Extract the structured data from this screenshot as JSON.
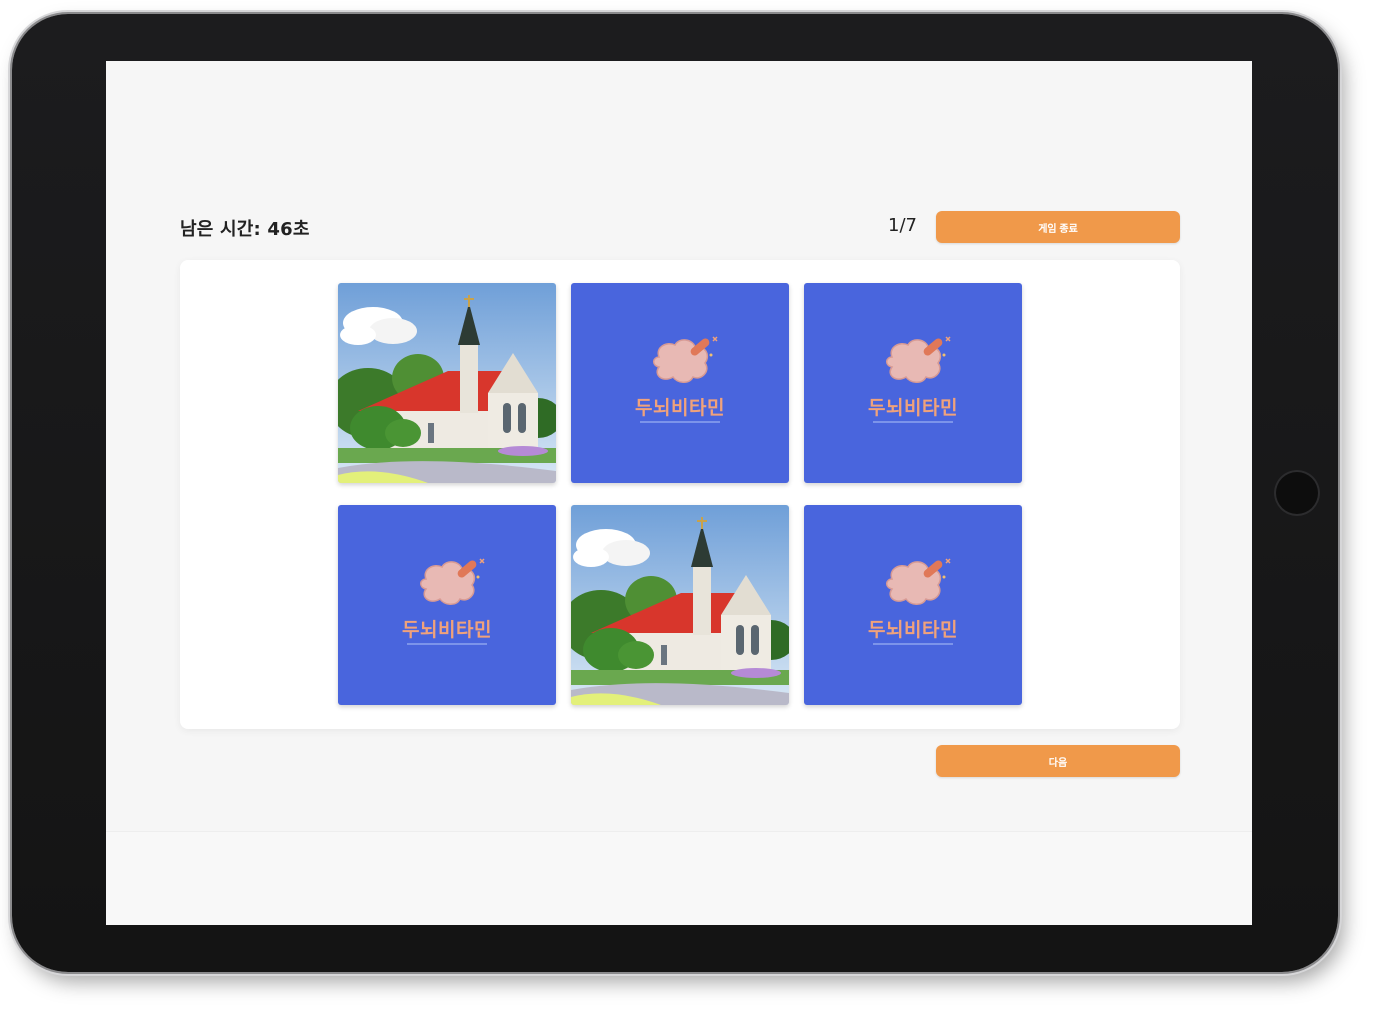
{
  "game": {
    "timer_text": "남은 시간: 46초",
    "progress_text": "1/7",
    "end_button_label": "게임 종료",
    "next_button_label": "다음"
  },
  "cards": [
    {
      "state": "face-up",
      "image": "church-image"
    },
    {
      "state": "face-down",
      "logo_text": "두뇌비타민"
    },
    {
      "state": "face-down",
      "logo_text": "두뇌비타민"
    },
    {
      "state": "face-down",
      "logo_text": "두뇌비타민"
    },
    {
      "state": "face-up",
      "image": "church-image"
    },
    {
      "state": "face-down",
      "logo_text": "두뇌비타민"
    }
  ],
  "colors": {
    "accent": "#f0994a",
    "card_back": "#4965dd",
    "logo_text": "#f0a27b"
  }
}
